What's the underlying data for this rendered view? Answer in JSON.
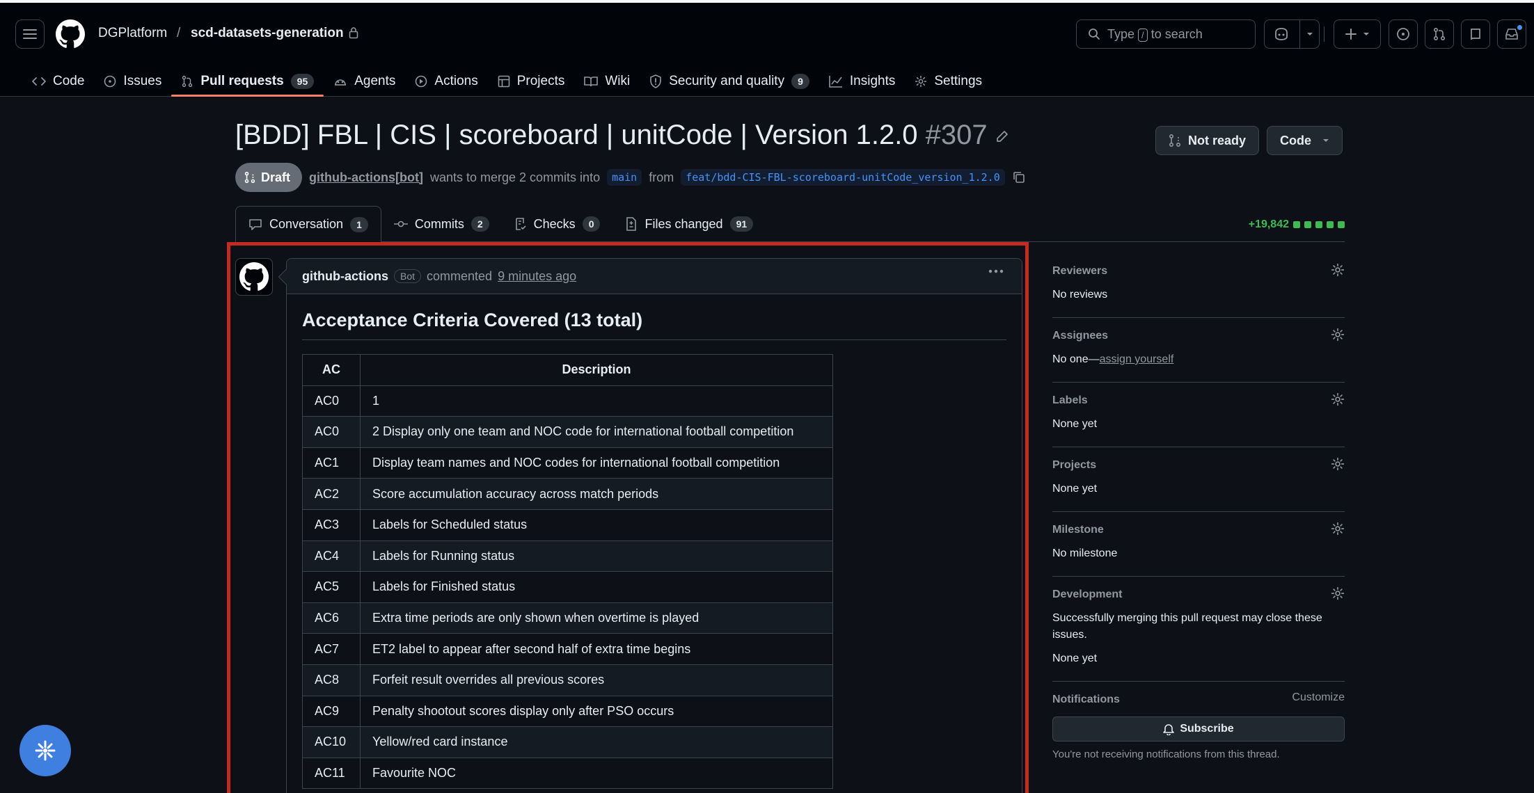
{
  "header": {
    "owner": "DGPlatform",
    "separator": "/",
    "repo": "scd-datasets-generation",
    "search_prefix": "Type",
    "search_key": "/",
    "search_suffix": "to search"
  },
  "nav": [
    {
      "label": "Code",
      "icon": "code-icon"
    },
    {
      "label": "Issues",
      "icon": "issue-icon"
    },
    {
      "label": "Pull requests",
      "icon": "pr-icon",
      "count": "95",
      "active": true
    },
    {
      "label": "Agents",
      "icon": "agents-icon"
    },
    {
      "label": "Actions",
      "icon": "play-icon"
    },
    {
      "label": "Projects",
      "icon": "table-icon"
    },
    {
      "label": "Wiki",
      "icon": "book-icon"
    },
    {
      "label": "Security and quality",
      "icon": "shield-icon",
      "count": "9"
    },
    {
      "label": "Insights",
      "icon": "graph-icon"
    },
    {
      "label": "Settings",
      "icon": "gear-icon"
    }
  ],
  "pr": {
    "title": "[BDD] FBL | CIS | scoreboard | unitCode | Version 1.2.0",
    "number": "#307",
    "status": "Draft",
    "author": "github-actions[bot]",
    "merge_text_1": "wants to merge 2 commits into",
    "base_branch": "main",
    "merge_text_2": "from",
    "head_branch": "feat/bdd-CIS-FBL-scoreboard-unitCode_version_1.2.0",
    "not_ready_label": "Not ready",
    "code_label": "Code"
  },
  "tabs": [
    {
      "label": "Conversation",
      "count": "1",
      "icon": "comment-icon",
      "active": true
    },
    {
      "label": "Commits",
      "count": "2",
      "icon": "commit-icon"
    },
    {
      "label": "Checks",
      "count": "0",
      "icon": "checklist-icon"
    },
    {
      "label": "Files changed",
      "count": "91",
      "icon": "file-diff-icon"
    }
  ],
  "diffstat": "+19,842",
  "comment": {
    "author": "github-actions",
    "badge": "Bot",
    "action": "commented",
    "time": "9 minutes ago",
    "heading": "Acceptance Criteria Covered (13 total)",
    "columns": [
      "AC",
      "Description"
    ],
    "rows": [
      [
        "AC0",
        "1"
      ],
      [
        "AC0",
        "2 Display only one team and NOC code for international football competition"
      ],
      [
        "AC1",
        "Display team names and NOC codes for international football competition"
      ],
      [
        "AC2",
        "Score accumulation accuracy across match periods"
      ],
      [
        "AC3",
        "Labels for Scheduled status"
      ],
      [
        "AC4",
        "Labels for Running status"
      ],
      [
        "AC5",
        "Labels for Finished status"
      ],
      [
        "AC6",
        "Extra time periods are only shown when overtime is played"
      ],
      [
        "AC7",
        "ET2 label to appear after second half of extra time begins"
      ],
      [
        "AC8",
        "Forfeit result overrides all previous scores"
      ],
      [
        "AC9",
        "Penalty shootout scores display only after PSO occurs"
      ],
      [
        "AC10",
        "Yellow/red card instance"
      ],
      [
        "AC11",
        "Favourite NOC"
      ]
    ]
  },
  "sidebar": {
    "reviewers": {
      "title": "Reviewers",
      "value": "No reviews"
    },
    "assignees": {
      "title": "Assignees",
      "value": "No one—",
      "link": "assign yourself"
    },
    "labels": {
      "title": "Labels",
      "value": "None yet"
    },
    "projects": {
      "title": "Projects",
      "value": "None yet"
    },
    "milestone": {
      "title": "Milestone",
      "value": "No milestone"
    },
    "development": {
      "title": "Development",
      "text": "Successfully merging this pull request may close these issues.",
      "value": "None yet"
    },
    "notifications": {
      "title": "Notifications",
      "customize": "Customize",
      "subscribe": "Subscribe",
      "note": "You're not receiving notifications from this thread."
    }
  }
}
